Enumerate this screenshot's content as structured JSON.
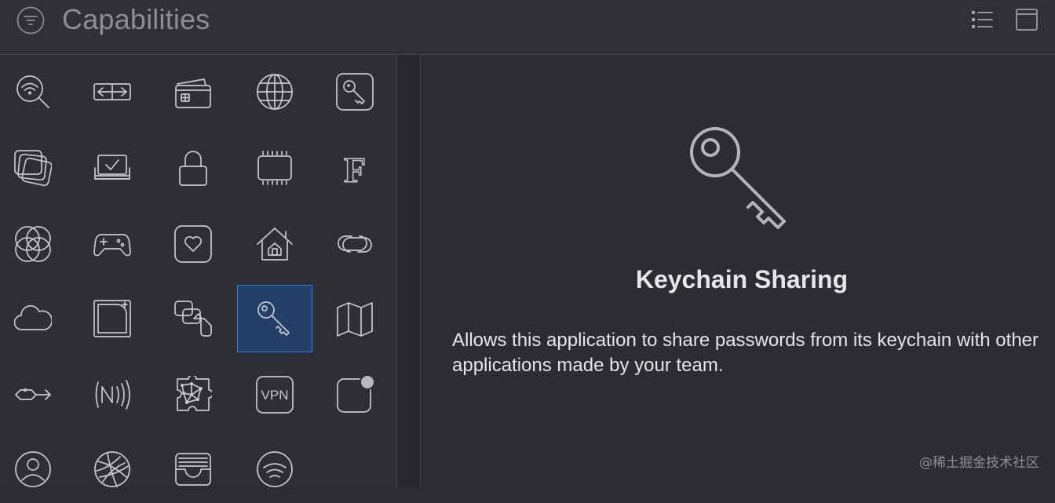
{
  "header": {
    "title": "Capabilities"
  },
  "library": {
    "icons": [
      "wifi-search-icon",
      "arrows-box-icon",
      "wallet-card-icon",
      "globe-icon",
      "key-square-icon",
      "stacked-cards-icon",
      "checked-tray-icon",
      "padlock-icon",
      "chip-icon",
      "font-f-icon",
      "overlapping-circles-icon",
      "game-controller-icon",
      "heart-square-icon",
      "home-icon",
      "link-icon",
      "cloud-icon",
      "notched-square-icon",
      "speech-bubbles-icon",
      "keychain-key-icon",
      "map-icon",
      "data-transfer-icon",
      "nfc-icon",
      "puzzle-network-icon",
      "vpn-icon",
      "notification-badge-icon",
      "person-circle-icon",
      "maps-globe-icon",
      "wallet-tray-icon",
      "wireless-circle-icon"
    ],
    "vpn_label": "VPN",
    "font_glyph": "F",
    "selected_index": 18
  },
  "detail": {
    "title": "Keychain Sharing",
    "description": "Allows this application to share passwords from its keychain with other applications made by your team."
  },
  "watermark": "@稀土掘金技术社区",
  "colors": {
    "background": "#2b2c31",
    "selection_fill": "#22406a",
    "selection_border": "#2f7ae5",
    "icon_stroke": "#c8c8cc",
    "title_text": "#8d8e94"
  }
}
